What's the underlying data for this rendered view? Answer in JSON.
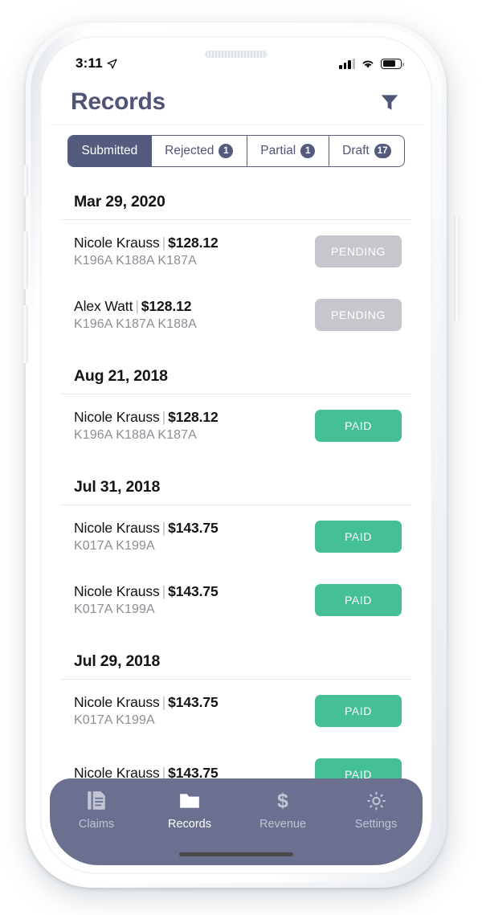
{
  "status_bar": {
    "time": "3:11",
    "location_icon": "location-arrow-icon",
    "signal_icon": "cellular-signal-icon",
    "wifi_icon": "wifi-icon",
    "battery_icon": "battery-icon"
  },
  "header": {
    "title": "Records",
    "filter_icon": "filter-funnel-icon"
  },
  "segmented": {
    "items": [
      {
        "label": "Submitted",
        "badge": "",
        "active": true
      },
      {
        "label": "Rejected",
        "badge": "1",
        "active": false
      },
      {
        "label": "Partial",
        "badge": "1",
        "active": false
      },
      {
        "label": "Draft",
        "badge": "17",
        "active": false
      }
    ]
  },
  "colors": {
    "accent_slate": "#555b7e",
    "title_slate": "#4e5577",
    "paid_green": "#45bf96",
    "pending_gray": "#c5c7cc",
    "tabbar": "#6b7090"
  },
  "sections": [
    {
      "date": "Mar 29, 2020",
      "records": [
        {
          "name": "Nicole Krauss",
          "separator": "|",
          "amount": "$128.12",
          "codes": "K196A K188A K187A",
          "status": "PENDING",
          "status_type": "pending"
        },
        {
          "name": "Alex Watt",
          "separator": "|",
          "amount": "$128.12",
          "codes": "K196A K187A K188A",
          "status": "PENDING",
          "status_type": "pending"
        }
      ]
    },
    {
      "date": "Aug 21, 2018",
      "records": [
        {
          "name": "Nicole Krauss",
          "separator": "|",
          "amount": "$128.12",
          "codes": "K196A K188A K187A",
          "status": "PAID",
          "status_type": "paid"
        }
      ]
    },
    {
      "date": "Jul 31, 2018",
      "records": [
        {
          "name": "Nicole Krauss",
          "separator": "|",
          "amount": "$143.75",
          "codes": "K017A K199A",
          "status": "PAID",
          "status_type": "paid"
        },
        {
          "name": "Nicole Krauss",
          "separator": "|",
          "amount": "$143.75",
          "codes": "K017A K199A",
          "status": "PAID",
          "status_type": "paid"
        }
      ]
    },
    {
      "date": "Jul 29, 2018",
      "records": [
        {
          "name": "Nicole Krauss",
          "separator": "|",
          "amount": "$143.75",
          "codes": "K017A K199A",
          "status": "PAID",
          "status_type": "paid"
        },
        {
          "name": "Nicole Krauss",
          "separator": "|",
          "amount": "$143.75",
          "codes": "",
          "status": "PAID",
          "status_type": "paid"
        }
      ]
    }
  ],
  "tabbar": {
    "items": [
      {
        "label": "Claims",
        "icon": "document-icon",
        "active": false
      },
      {
        "label": "Records",
        "icon": "folder-icon",
        "active": true
      },
      {
        "label": "Revenue",
        "icon": "dollar-icon",
        "active": false
      },
      {
        "label": "Settings",
        "icon": "gear-icon",
        "active": false
      }
    ]
  }
}
